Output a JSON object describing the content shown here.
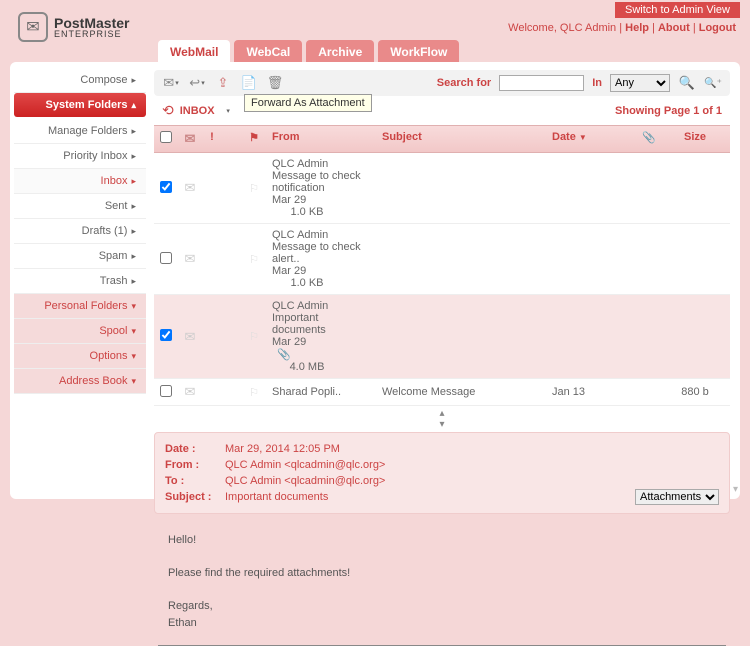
{
  "topbar": {
    "switch": "Switch to Admin View"
  },
  "welcome": {
    "text": "Welcome, QLC Admin ",
    "help": "Help",
    "about": "About",
    "logout": "Logout"
  },
  "logo": {
    "main": "PostMaster",
    "sub": "ENTERPRISE"
  },
  "tabs": [
    "WebMail",
    "WebCal",
    "Archive",
    "WorkFlow"
  ],
  "sidebar": {
    "compose": "Compose",
    "system_folders": "System Folders",
    "items": [
      "Manage Folders",
      "Priority Inbox",
      "Inbox",
      "Sent",
      "Drafts (1)",
      "Spam",
      "Trash"
    ],
    "personal_folders": "Personal Folders",
    "spool": "Spool",
    "options": "Options",
    "address_book": "Address Book"
  },
  "toolbar": {
    "tooltip": "Forward As Attachment",
    "search_label": "Search for",
    "in_label": "In",
    "in_value": "Any"
  },
  "folderbar": {
    "name": "INBOX",
    "paging": "Showing Page 1 of 1"
  },
  "columns": {
    "from": "From",
    "subject": "Subject",
    "date": "Date",
    "size": "Size"
  },
  "messages": [
    {
      "checked": true,
      "from": "QLC Admin <q..",
      "subject": "Message to check notification",
      "date": "Mar 29",
      "clip": false,
      "size": "1.0 KB"
    },
    {
      "checked": false,
      "from": "QLC Admin <q..",
      "subject": "Message to check alert..",
      "date": "Mar 29",
      "clip": false,
      "size": "1.0 KB"
    },
    {
      "checked": true,
      "from": "QLC Admin <q..",
      "subject": "Important documents",
      "date": "Mar 29",
      "clip": true,
      "size": "4.0 MB",
      "selected": true
    },
    {
      "checked": false,
      "from": "Sharad Popli..",
      "subject": "Welcome Message",
      "date": "Jan 13",
      "clip": false,
      "size": "880 b"
    }
  ],
  "preview": {
    "date_lbl": "Date :",
    "date_val": "Mar 29, 2014 12:05 PM",
    "from_lbl": "From :",
    "from_val": "QLC Admin <qlcadmin@qlc.org>",
    "to_lbl": "To :",
    "to_val": "QLC Admin <qlcadmin@qlc.org>",
    "subj_lbl": "Subject :",
    "subj_val": "Important documents",
    "attach": "Attachments",
    "body_l1": "Hello!",
    "body_l2": "Please find the required attachments!",
    "body_l3": "Regards,",
    "body_l4": "Ethan"
  }
}
